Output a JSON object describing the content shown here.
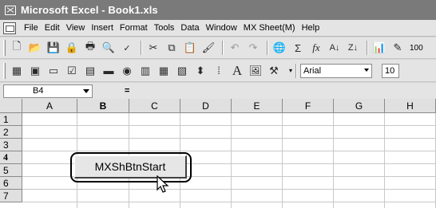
{
  "window": {
    "title": "Microsoft Excel - Book1.xls"
  },
  "menu": [
    "File",
    "Edit",
    "View",
    "Insert",
    "Format",
    "Tools",
    "Data",
    "Window",
    "MX Sheet(M)",
    "Help"
  ],
  "toolbar1": {
    "zoom": "100"
  },
  "toolbar2": {
    "font": "Arial",
    "size": "10"
  },
  "formula": {
    "name_box": "B4",
    "equals": "="
  },
  "columns": [
    "A",
    "B",
    "C",
    "D",
    "E",
    "F",
    "G",
    "H"
  ],
  "active_column": "B",
  "rows": [
    "1",
    "2",
    "3",
    "4",
    "5",
    "6",
    "7"
  ],
  "active_row": "4",
  "sheet_button": {
    "label": "MXShBtnStart"
  }
}
